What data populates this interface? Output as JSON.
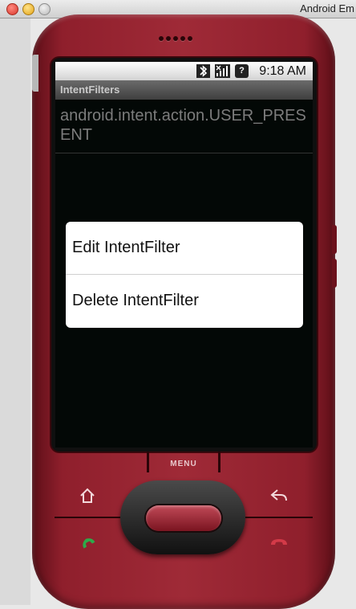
{
  "window": {
    "title": "Android Em"
  },
  "status_bar": {
    "time": "9:18 AM",
    "icons": [
      "bluetooth-icon",
      "signal-icon",
      "unknown-icon"
    ],
    "unknown_icon_label": "?"
  },
  "app": {
    "title": "IntentFilters",
    "list_items": [
      {
        "label": "android.intent.action.USER_PRESENT"
      }
    ]
  },
  "context_menu": {
    "items": [
      {
        "label": "Edit IntentFilter"
      },
      {
        "label": "Delete IntentFilter"
      }
    ]
  },
  "hardware": {
    "menu_label": "MENU",
    "buttons": [
      "home-icon",
      "back-icon",
      "call-icon",
      "end-call-icon"
    ]
  },
  "colors": {
    "phone_body": "#8f1f2c",
    "screen_bg": "#030806",
    "dialog_bg": "#ffffff",
    "call_green": "#2eaa4a",
    "end_red": "#d33a48"
  }
}
